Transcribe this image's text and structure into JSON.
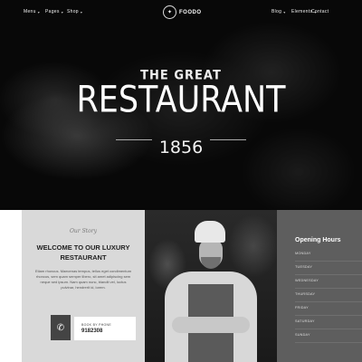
{
  "nav": {
    "left": [
      {
        "label": "Menu"
      },
      {
        "label": "Pages"
      },
      {
        "label": "Shop"
      }
    ],
    "logo_text": "FOODO",
    "right": [
      {
        "label": "Blog"
      },
      {
        "label": "Elements"
      },
      {
        "label": "Contact"
      }
    ]
  },
  "hero": {
    "pre_title": "THE GREAT",
    "title": "RESTAURANT",
    "year": "1856"
  },
  "welcome": {
    "script": "Our Story",
    "title": "WELCOME TO OUR LUXURY RESTAURANT",
    "body": "Etiam rhoncus. Maecenas tempus, tellus eget condimentum rhoncus, sem quam semper libero, sit amet adipiscing sem neque sed ipsum. Nam quam nunc, blandit vel, luctus pulvinar, hendrerit id, lorem.",
    "phone_icon": "phone-icon",
    "call_label": "BOOK BY PHONE",
    "call_number": "9182308"
  },
  "hours": {
    "title": "Opening Hours",
    "rows": [
      {
        "day": "MONDAY",
        "time": ""
      },
      {
        "day": "TUESDAY",
        "time": ""
      },
      {
        "day": "WEDNESDAY",
        "time": ""
      },
      {
        "day": "THURSDAY",
        "time": ""
      },
      {
        "day": "FRIDAY",
        "time": ""
      },
      {
        "day": "SATURDAY",
        "time": ""
      },
      {
        "day": "SUNDAY",
        "time": ""
      }
    ]
  }
}
